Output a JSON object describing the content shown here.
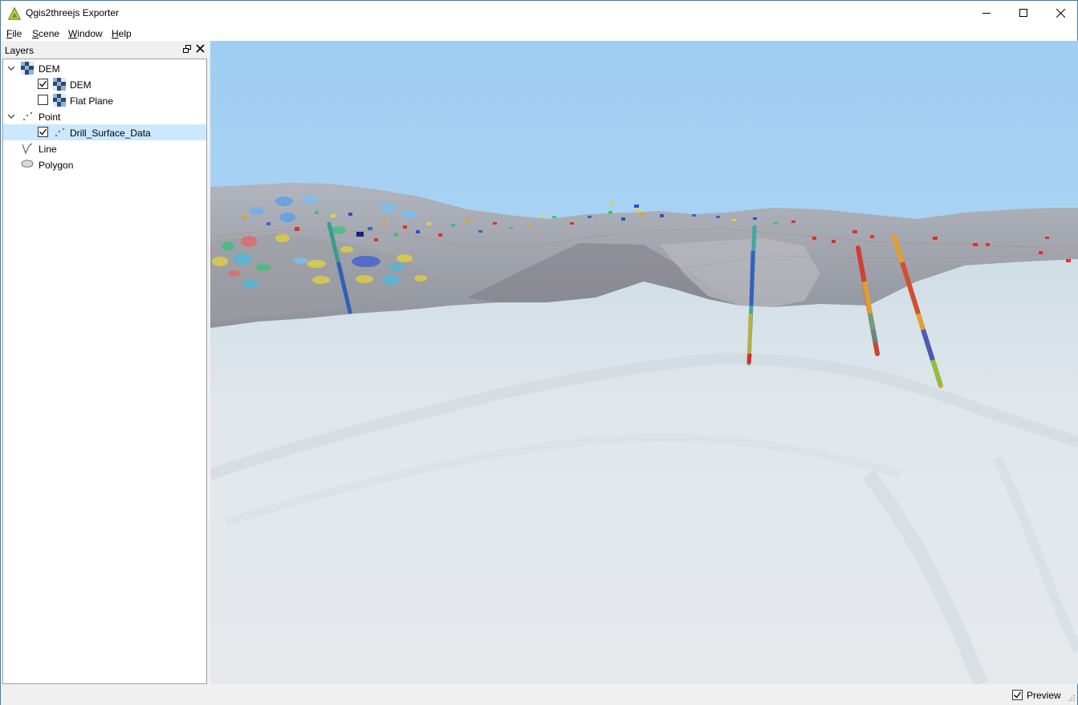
{
  "window": {
    "title": "Qgis2threejs Exporter"
  },
  "menubar": {
    "items": [
      {
        "accel": "F",
        "rest": "ile"
      },
      {
        "accel": "S",
        "rest": "cene"
      },
      {
        "accel": "W",
        "rest": "indow"
      },
      {
        "accel": "H",
        "rest": "elp"
      }
    ]
  },
  "layers_panel": {
    "title": "Layers",
    "groups": {
      "dem": {
        "label": "DEM",
        "expanded": true,
        "children": [
          {
            "label": "DEM",
            "checked": true
          },
          {
            "label": "Flat Plane",
            "checked": false
          }
        ]
      },
      "point": {
        "label": "Point",
        "expanded": true,
        "children": [
          {
            "label": "Drill_Surface_Data",
            "checked": true,
            "selected": true
          }
        ]
      },
      "line": {
        "label": "Line"
      },
      "polygon": {
        "label": "Polygon"
      }
    }
  },
  "statusbar": {
    "preview_label": "Preview",
    "preview_checked": true
  },
  "colors": {
    "sky_top": "#9fcdf3",
    "sky_bottom": "#c2dff8",
    "terrain_far": "#a3a3a8",
    "terrain_near": "#e3e9ee",
    "selection": "#cce8ff",
    "window_border": "#3c7fb1"
  },
  "icons": {
    "app": "qgis-triangle-icon",
    "raster": "raster-grid-icon",
    "point": "point-layer-icon",
    "line": "line-layer-icon",
    "polygon": "polygon-layer-icon"
  }
}
